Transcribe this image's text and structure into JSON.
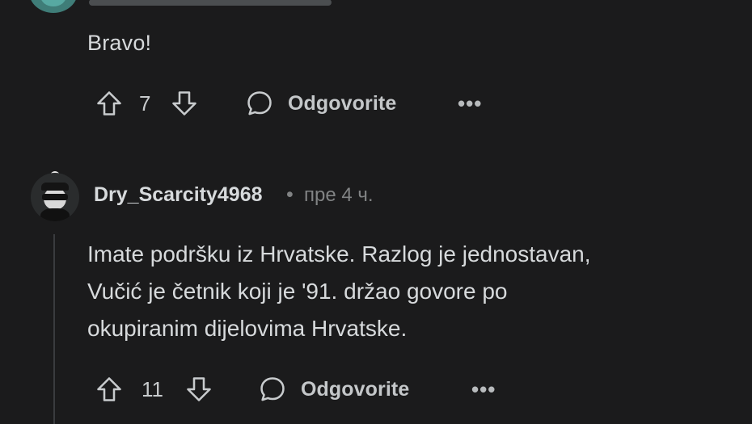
{
  "comment_1": {
    "text": "Bravo!",
    "votes": "7",
    "reply_label": "Odgovorite",
    "more_label": "•••"
  },
  "comment_2": {
    "username": "Dry_Scarcity4968",
    "separator": "•",
    "time": "пре 4 ч.",
    "text_lines": [
      "Imate podršku iz Hrvatske. Razlog je jednostavan,",
      "Vučić je četnik koji je '91. držao govore po",
      "okupiranim dijelovima Hrvatske."
    ],
    "votes": "11",
    "reply_label": "Odgovorite",
    "more_label": "•••"
  },
  "colors": {
    "background": "#1b1b1c",
    "text": "#d7dadc",
    "muted": "#818384"
  }
}
